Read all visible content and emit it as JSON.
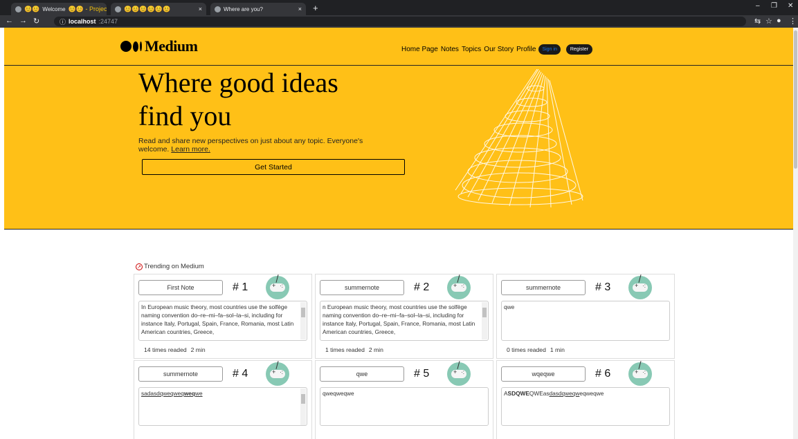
{
  "browser": {
    "tabs": [
      {
        "label": "Welcome",
        "prefix_emoji": "😊😊",
        "suffix": "😊😊 - ProjectM"
      },
      {
        "label": "😊😊😊😊😊😊"
      },
      {
        "label": "Where are you?"
      }
    ],
    "url_host": "localhost",
    "url_port": ":24747"
  },
  "header": {
    "logo_text": "Medium",
    "nav": [
      "Home Page",
      "Notes",
      "Topics",
      "Our Story",
      "Profile"
    ],
    "sign_in": "Sign in",
    "register": "Register"
  },
  "hero": {
    "headline_line1": "Where good ideas",
    "headline_line2": "find you",
    "sub_text": "Read and share new perspectives on just about any topic. Everyone's welcome.",
    "learn_more": "Learn more.",
    "cta": "Get Started"
  },
  "trending": {
    "label": "Trending on Medium",
    "cards": [
      {
        "title": "First Note",
        "rank": "# 1",
        "text": "In European music theory, most countries use the solfège naming convention do–re–mi–fa–sol–la–si, including for instance Italy, Portugal, Spain, France, Romania, most Latin American countries, Greece,",
        "reads": "14 times readed",
        "time": "2 min"
      },
      {
        "title": "summernote",
        "rank": "# 2",
        "text": "n European music theory, most countries use the solfège naming convention do–re–mi–fa–sol–la–si, including for instance Italy, Portugal, Spain, France, Romania, most Latin American countries, Greece,",
        "reads": "1 times readed",
        "time": "2 min"
      },
      {
        "title": "summernote",
        "rank": "# 3",
        "text": "qwe",
        "reads": "0 times readed",
        "time": "1 min"
      },
      {
        "title": "summernote",
        "rank": "# 4",
        "text_parts": {
          "a": "sadasdqweqweq",
          "b": "weq",
          "c": "we"
        }
      },
      {
        "title": "qwe",
        "rank": "# 5",
        "text": "qweqweqwe"
      },
      {
        "title": "wqeqwe",
        "rank": "# 6",
        "text_parts": {
          "a": "A",
          "b": "SDQWE",
          "c": "QWEas",
          "d": "dasdqweqw",
          "e": "eqweqwe"
        }
      }
    ]
  }
}
